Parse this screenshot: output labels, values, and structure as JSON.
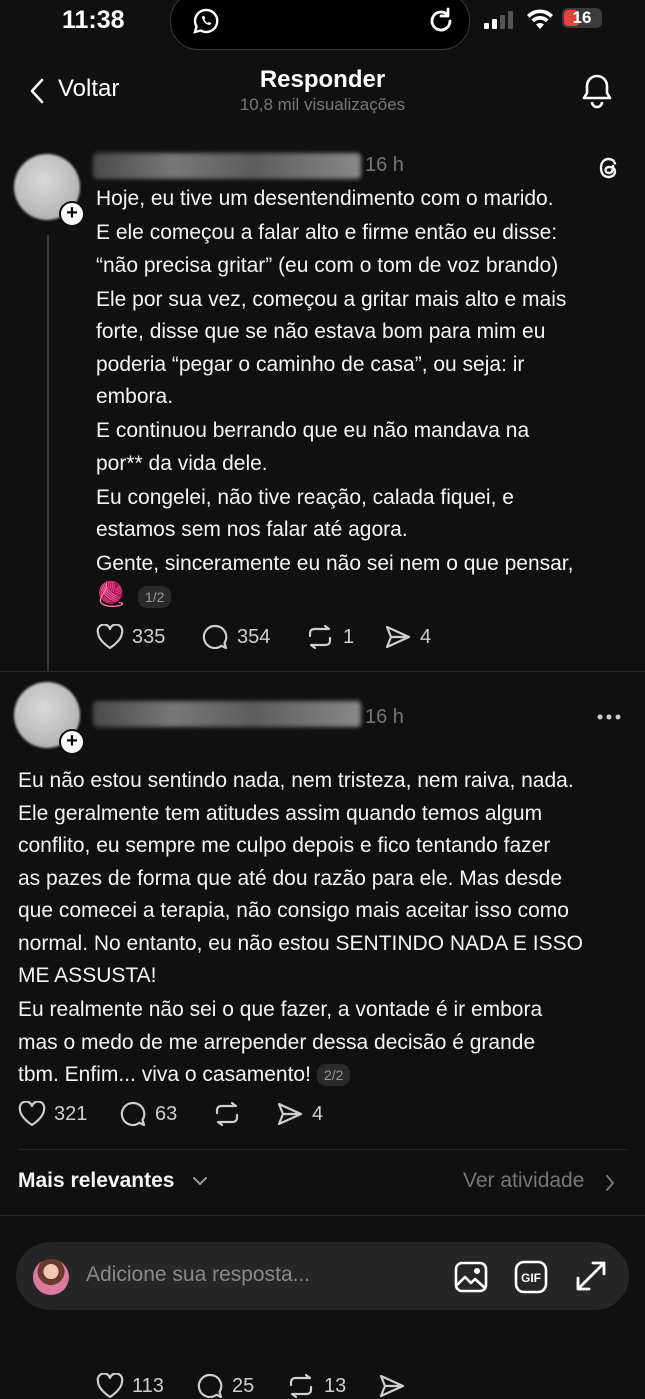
{
  "status_bar": {
    "time": "11:38",
    "battery": "16"
  },
  "header": {
    "back_label": "Voltar",
    "title": "Responder",
    "subtitle": "10,8 mil visualizações"
  },
  "post1": {
    "time": "16 h",
    "paragraphs": [
      "Hoje, eu tive um desentendimento com o marido.",
      "E ele começou a falar alto e firme então eu disse:\n“não precisa gritar” (eu com o tom de voz brando)",
      "Ele por sua vez, começou a gritar mais alto e mais\nforte, disse que se não estava bom para mim eu\npoderia “pegar o caminho de casa”, ou seja: ir\nembora.",
      "E continuou berrando que eu não mandava na\npor** da vida dele.",
      "Eu congelei, não tive reação, calada fiquei, e\nestamos sem nos falar até agora.",
      "Gente, sinceramente eu não sei nem o que pensar,"
    ],
    "emoji": "🧶",
    "pager": "1/2",
    "likes": "335",
    "comments": "354",
    "reposts": "1",
    "shares": "4"
  },
  "post2": {
    "time": "16 h",
    "paragraphs": [
      "Eu não estou sentindo nada, nem tristeza, nem raiva, nada.\nEle geralmente tem atitudes assim quando temos algum\nconflito, eu sempre me culpo depois e fico tentando fazer\nas pazes de forma que até dou razão para ele. Mas desde\nque comecei a terapia, não consigo mais aceitar isso como\nnormal. No entanto, eu não estou SENTINDO NADA E ISSO\nME ASSUSTA!",
      "Eu realmente não sei o que fazer, a vontade é ir embora\nmas o medo de me arrepender dessa decisão é grande\ntbm. Enfim... viva o casamento!"
    ],
    "pager": "2/2",
    "likes": "321",
    "comments": "63",
    "shares": "4"
  },
  "filter": {
    "label": "Mais relevantes",
    "activity": "Ver atividade"
  },
  "reply": {
    "placeholder": "Adicione sua resposta..."
  },
  "next_post": {
    "likes": "113",
    "comments": "25",
    "reposts": "13"
  },
  "icons": [
    "whatsapp-icon",
    "refresh-icon",
    "signal-icon",
    "wifi-icon",
    "battery-icon",
    "back-chevron-icon",
    "bell-icon",
    "threads-icon",
    "heart-icon",
    "comment-icon",
    "repost-icon",
    "share-icon",
    "more-icon",
    "chevron-down-icon",
    "chevron-right-icon",
    "image-icon",
    "gif-icon",
    "expand-icon"
  ],
  "colors": {
    "background": "#101010",
    "text": "#f3f5f7",
    "muted": "#777777",
    "battery_low": "#e0443e"
  }
}
